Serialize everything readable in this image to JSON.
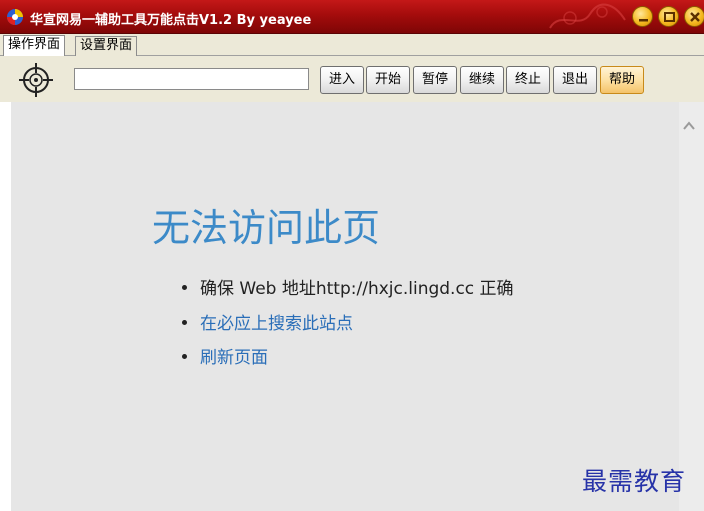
{
  "window": {
    "title": "华宣网易一辅助工具万能点击V1.2  By yeayee"
  },
  "tabs": [
    {
      "label": "操作界面",
      "active": true
    },
    {
      "label": "设置界面",
      "active": false
    }
  ],
  "toolbar": {
    "url_value": "",
    "buttons": [
      {
        "label": "进入"
      },
      {
        "label": "开始"
      },
      {
        "label": "暂停"
      },
      {
        "label": "继续"
      },
      {
        "label": "终止"
      },
      {
        "label": "退出"
      },
      {
        "label": "帮助",
        "active": true
      }
    ]
  },
  "error_page": {
    "title": "无法访问此页",
    "items": [
      {
        "text": "确保 Web 地址http://hxjc.lingd.cc 正确",
        "link": false
      },
      {
        "text": "在必应上搜索此站点",
        "link": true
      },
      {
        "text": "刷新页面",
        "link": true
      }
    ]
  },
  "watermark": "最需教育",
  "colors": {
    "titlebar": "#a40c0c",
    "error_title": "#3c8ac8",
    "link": "#2a6eb8",
    "watermark": "#2733a8"
  }
}
